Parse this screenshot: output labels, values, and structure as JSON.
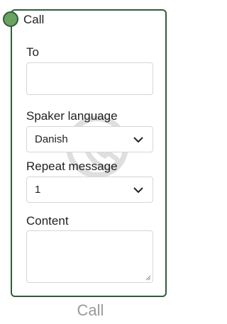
{
  "node": {
    "title": "Call",
    "footer_label": "Call",
    "accent_color": "#6aa35f",
    "border_color": "#2f5d3a",
    "watermark_icon": "phone-icon"
  },
  "fields": {
    "to": {
      "label": "To",
      "value": ""
    },
    "speaker_language": {
      "label": "Spaker language",
      "selected": "Danish"
    },
    "repeat_message": {
      "label": "Repeat message",
      "selected": "1"
    },
    "content": {
      "label": "Content",
      "value": ""
    }
  }
}
